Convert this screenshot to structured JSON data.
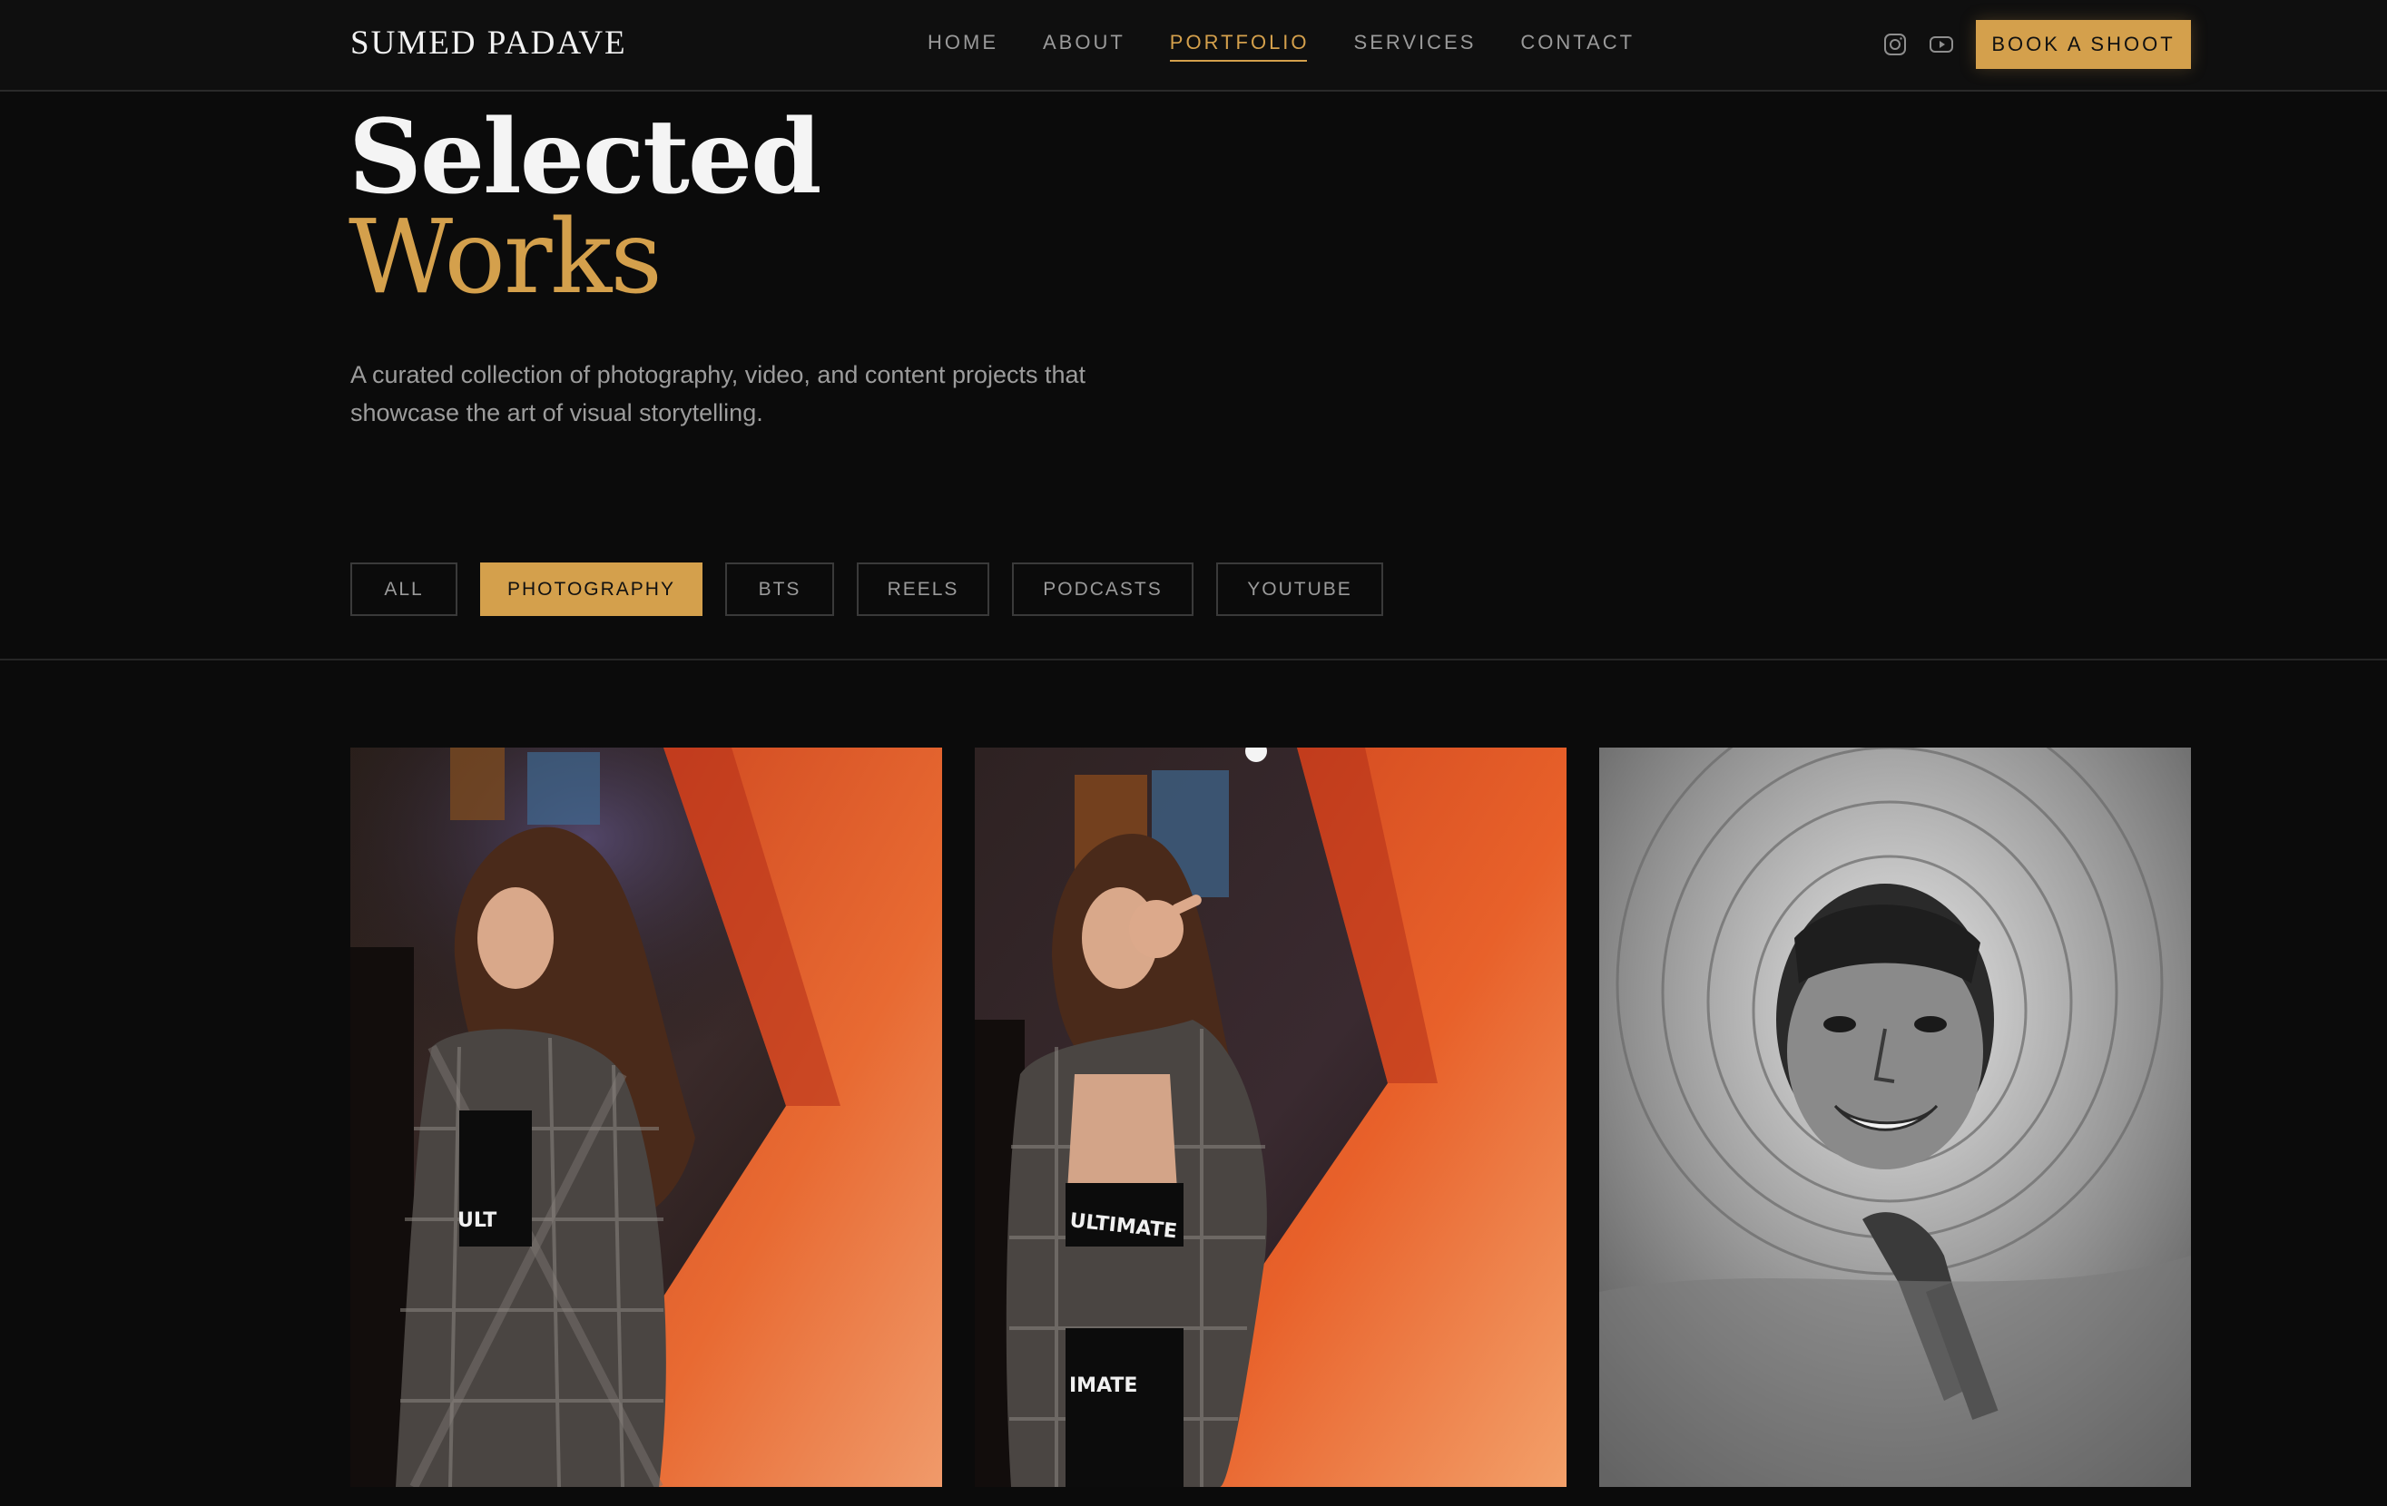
{
  "header": {
    "logo": "SUMED PADAVE",
    "nav": [
      {
        "label": "HOME",
        "active": false
      },
      {
        "label": "ABOUT",
        "active": false
      },
      {
        "label": "PORTFOLIO",
        "active": true
      },
      {
        "label": "SERVICES",
        "active": false
      },
      {
        "label": "CONTACT",
        "active": false
      }
    ],
    "social_icons": [
      "instagram-icon",
      "youtube-icon"
    ],
    "cta_label": "BOOK A SHOOT"
  },
  "hero": {
    "title_line1": "Selected",
    "title_line2": "Works",
    "subtitle": "A curated collection of photography, video, and content projects that showcase the art of visual storytelling."
  },
  "filters": [
    {
      "label": "ALL",
      "active": false
    },
    {
      "label": "PHOTOGRAPHY",
      "active": true
    },
    {
      "label": "BTS",
      "active": false
    },
    {
      "label": "REELS",
      "active": false
    },
    {
      "label": "PODCASTS",
      "active": false
    },
    {
      "label": "YOUTUBE",
      "active": false
    }
  ],
  "gallery": [
    {
      "shirt_text": "ULT"
    },
    {
      "shirt_text": "ULTIMATE",
      "shorts_text": "IMATE"
    },
    {}
  ],
  "colors": {
    "accent": "#d4a04c",
    "background": "#0b0b0b",
    "muted_text": "#9a9a9a"
  }
}
